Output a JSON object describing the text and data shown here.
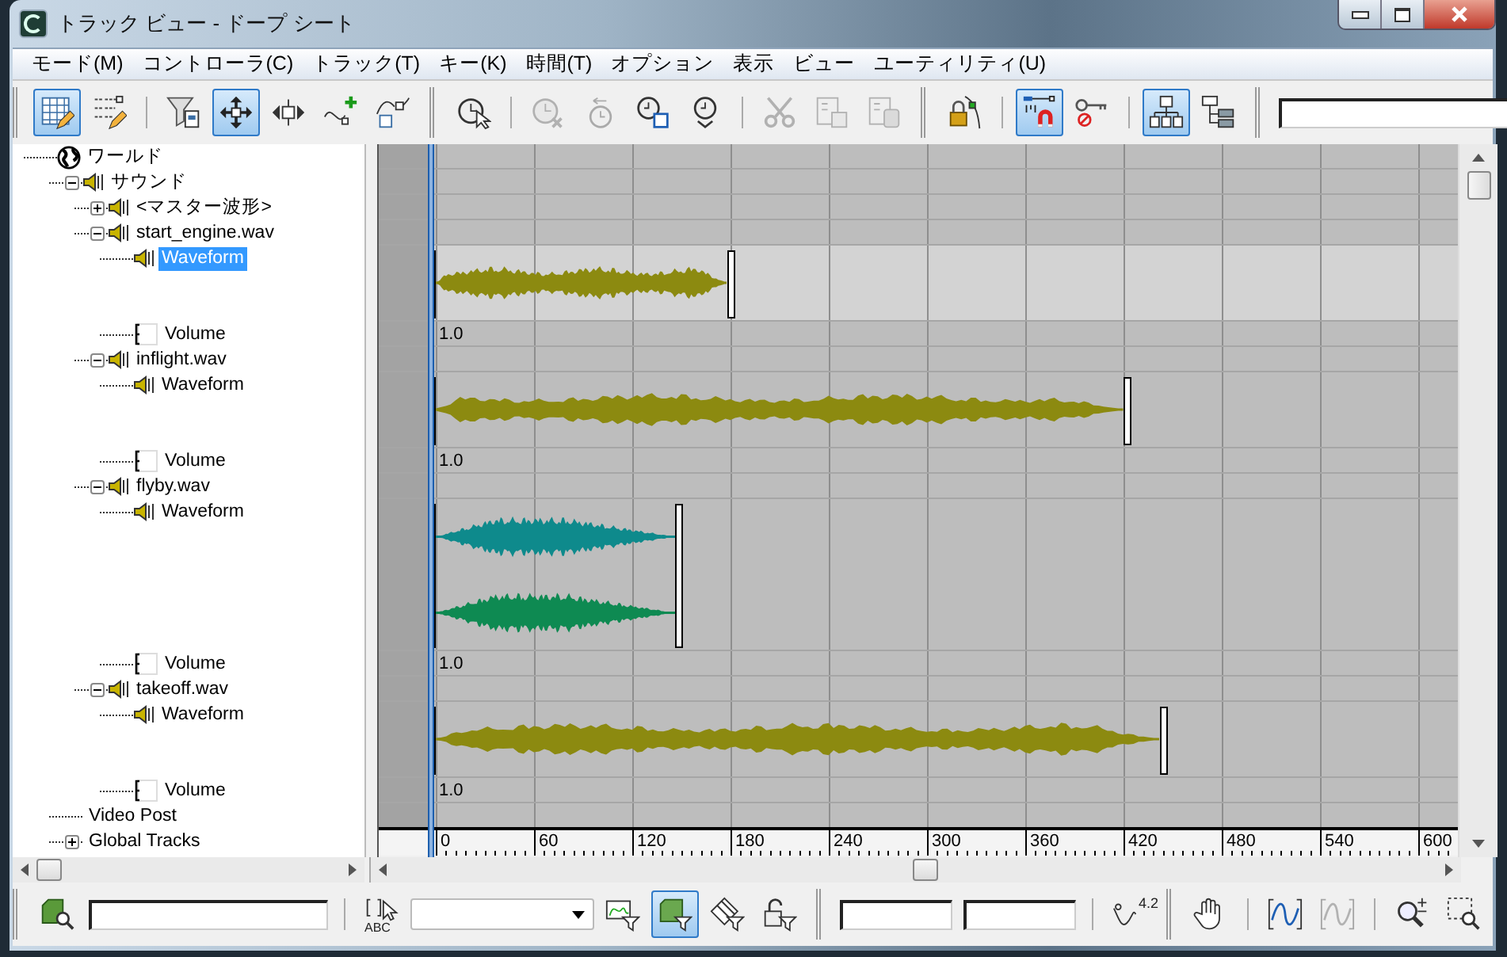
{
  "window": {
    "title": "トラック ビュー - ドープ シート"
  },
  "menu": [
    "モード(M)",
    "コントローラ(C)",
    "トラック(T)",
    "キー(K)",
    "時間(T)",
    "オプション",
    "表示",
    "ビュー",
    "ユーティリティ(U)"
  ],
  "toolbar": {
    "buttons": [
      {
        "selected": true,
        "disabled": false
      },
      {
        "selected": false,
        "disabled": false
      },
      {
        "selected": false,
        "disabled": false
      },
      {
        "selected": true,
        "disabled": false
      },
      {
        "selected": false,
        "disabled": false
      },
      {
        "selected": false,
        "disabled": false
      },
      {
        "selected": false,
        "disabled": false
      },
      {
        "selected": false,
        "disabled": false
      },
      {
        "selected": false,
        "disabled": true
      },
      {
        "selected": false,
        "disabled": true
      },
      {
        "selected": false,
        "disabled": false
      },
      {
        "selected": false,
        "disabled": false
      },
      {
        "selected": false,
        "disabled": true
      },
      {
        "selected": false,
        "disabled": true
      },
      {
        "selected": false,
        "disabled": true
      },
      {
        "selected": false,
        "disabled": false
      },
      {
        "selected": true,
        "disabled": false
      },
      {
        "selected": false,
        "disabled": false
      },
      {
        "selected": true,
        "disabled": false
      },
      {
        "selected": false,
        "disabled": false
      }
    ]
  },
  "tree": [
    {
      "label": "ワールド",
      "kind": "world",
      "selected": false,
      "children": [
        {
          "label": "サウンド",
          "kind": "sound",
          "expanded": true,
          "selected": false,
          "children": [
            {
              "label": "<マスター波形>",
              "kind": "sound",
              "expanded": false,
              "selected": false
            },
            {
              "label": "start_engine.wav",
              "kind": "sound",
              "expanded": true,
              "selected": false,
              "children": [
                {
                  "label": "Waveform",
                  "kind": "waveform",
                  "selected": true,
                  "clip": {
                    "level": 0.29,
                    "waves": [
                      {
                        "color": "#8c8a10"
                      }
                    ]
                  }
                },
                {
                  "label": "Volume",
                  "kind": "volume",
                  "selected": false,
                  "value": "1.0"
                }
              ]
            },
            {
              "label": "inflight.wav",
              "kind": "sound",
              "expanded": true,
              "selected": false,
              "children": [
                {
                  "label": "Waveform",
                  "kind": "waveform",
                  "selected": false,
                  "clip": {
                    "level": 0.675,
                    "waves": [
                      {
                        "color": "#8c8a10"
                      }
                    ]
                  }
                },
                {
                  "label": "Volume",
                  "kind": "volume",
                  "selected": false,
                  "value": "1.0"
                }
              ]
            },
            {
              "label": "flyby.wav",
              "kind": "sound",
              "expanded": true,
              "selected": false,
              "children": [
                {
                  "label": "Waveform",
                  "kind": "waveform",
                  "selected": false,
                  "clip": {
                    "level": 0.24,
                    "waves": [
                      {
                        "color": "#0e8a8c"
                      },
                      {
                        "color": "#0e8a52"
                      }
                    ]
                  }
                },
                {
                  "label": "Volume",
                  "kind": "volume",
                  "selected": false,
                  "value": "1.0"
                }
              ]
            },
            {
              "label": "takeoff.wav",
              "kind": "sound",
              "expanded": true,
              "selected": false,
              "children": [
                {
                  "label": "Waveform",
                  "kind": "waveform",
                  "selected": false,
                  "clip": {
                    "level": 0.71,
                    "waves": [
                      {
                        "color": "#8c8a10"
                      }
                    ]
                  }
                },
                {
                  "label": "Volume",
                  "kind": "volume",
                  "selected": false,
                  "value": "1.0"
                }
              ]
            }
          ]
        },
        {
          "label": "Video Post",
          "kind": "plain",
          "selected": false
        },
        {
          "label": "Global Tracks",
          "kind": "plain",
          "expanded": false,
          "selected": false
        }
      ]
    }
  ],
  "time_slider": {
    "level": 0.045
  },
  "ruler": {
    "labels": [
      "0",
      "60",
      "120",
      "180",
      "240",
      "300",
      "360",
      "420",
      "480",
      "540",
      "600"
    ]
  },
  "bottom_toolbar": {
    "abc_label": "ABC",
    "curve_value": "4.2",
    "buttons": [
      {
        "selected": false,
        "disabled": false
      },
      {
        "selected": false,
        "disabled": false
      },
      {
        "selected": false,
        "disabled": false
      },
      {
        "selected": true,
        "disabled": false
      },
      {
        "selected": false,
        "disabled": false
      },
      {
        "selected": false,
        "disabled": false
      },
      {
        "selected": false,
        "disabled": false
      },
      {
        "selected": false,
        "disabled": false
      },
      {
        "selected": false,
        "disabled": false
      },
      {
        "selected": false,
        "disabled": true
      },
      {
        "selected": false,
        "disabled": false
      },
      {
        "selected": false,
        "disabled": false
      }
    ]
  }
}
